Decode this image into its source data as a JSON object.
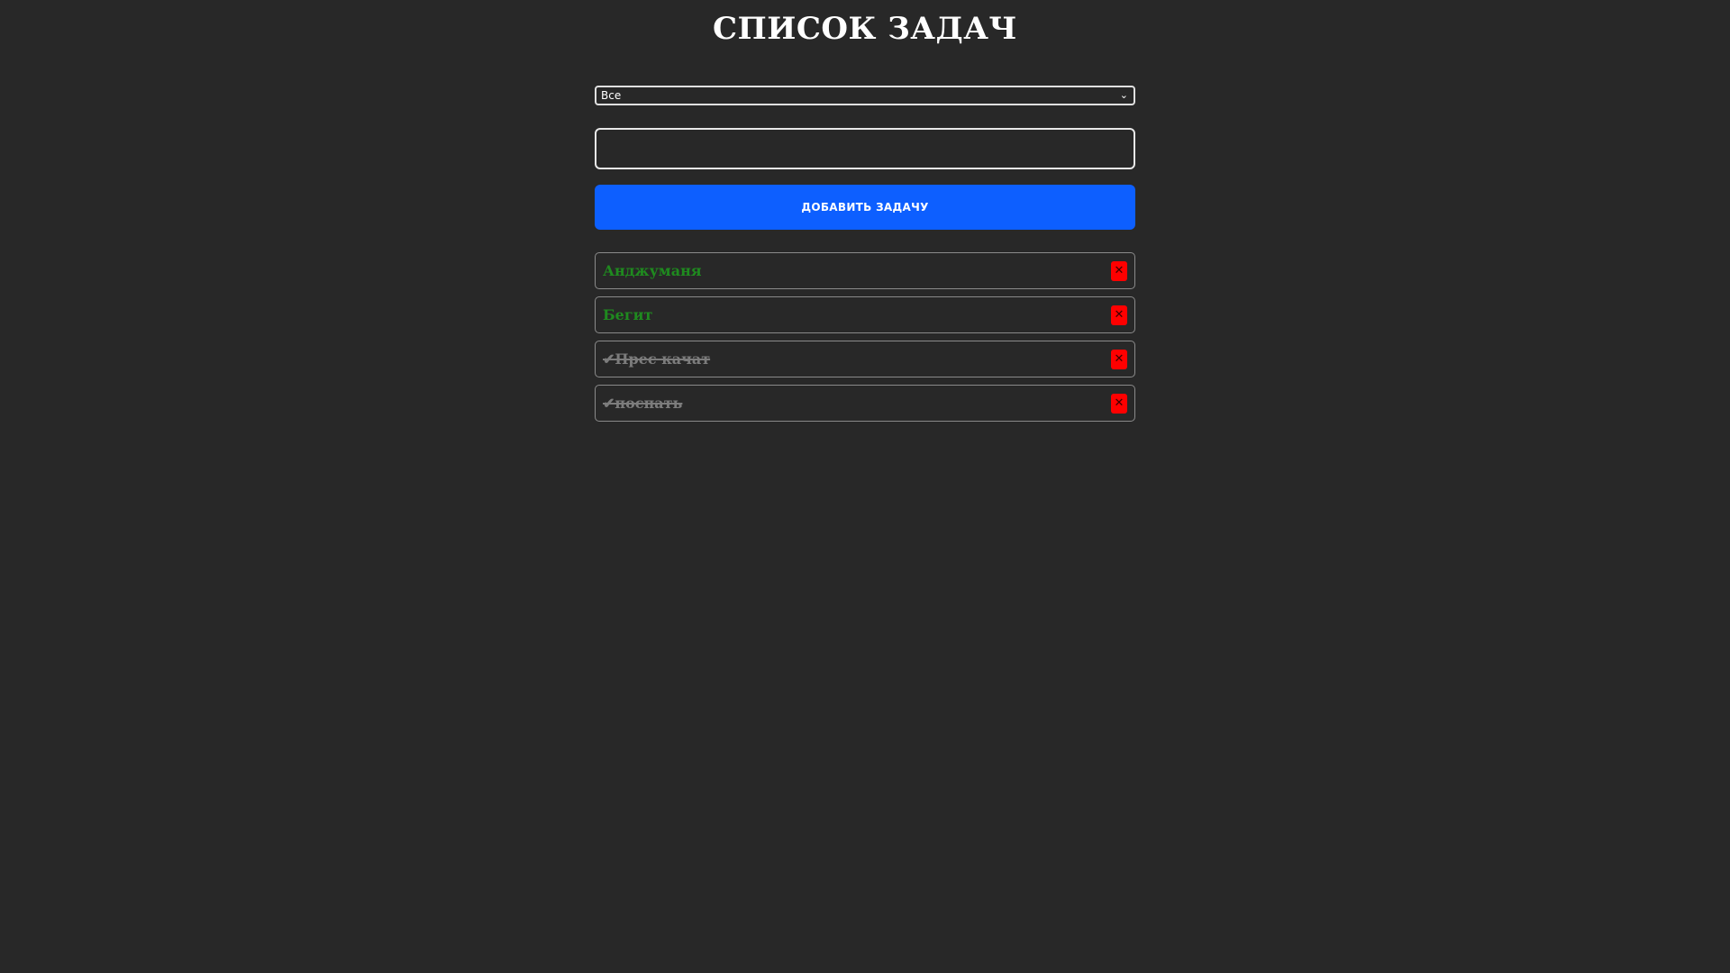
{
  "header": {
    "title": "СПИСОК ЗАДАЧ"
  },
  "filter": {
    "selected": "Все",
    "icon": "chevron-down-icon"
  },
  "new_task": {
    "value": "",
    "placeholder": ""
  },
  "add_button": {
    "label": "ДОБАВИТЬ ЗАДАЧУ"
  },
  "tasks": [
    {
      "text": "Анджуманя",
      "status": "active"
    },
    {
      "text": "Бегит",
      "status": "active"
    },
    {
      "text": "✔Прес качат",
      "status": "done"
    },
    {
      "text": "✔поспать",
      "status": "done"
    }
  ],
  "delete_button": {
    "glyph": "✕",
    "icon": "close-icon"
  },
  "colors": {
    "background": "#282828",
    "accent": "#0d5fff",
    "active_task": "#1f8a1f",
    "done_task": "#7c7c7c",
    "delete": "#ff0000"
  }
}
